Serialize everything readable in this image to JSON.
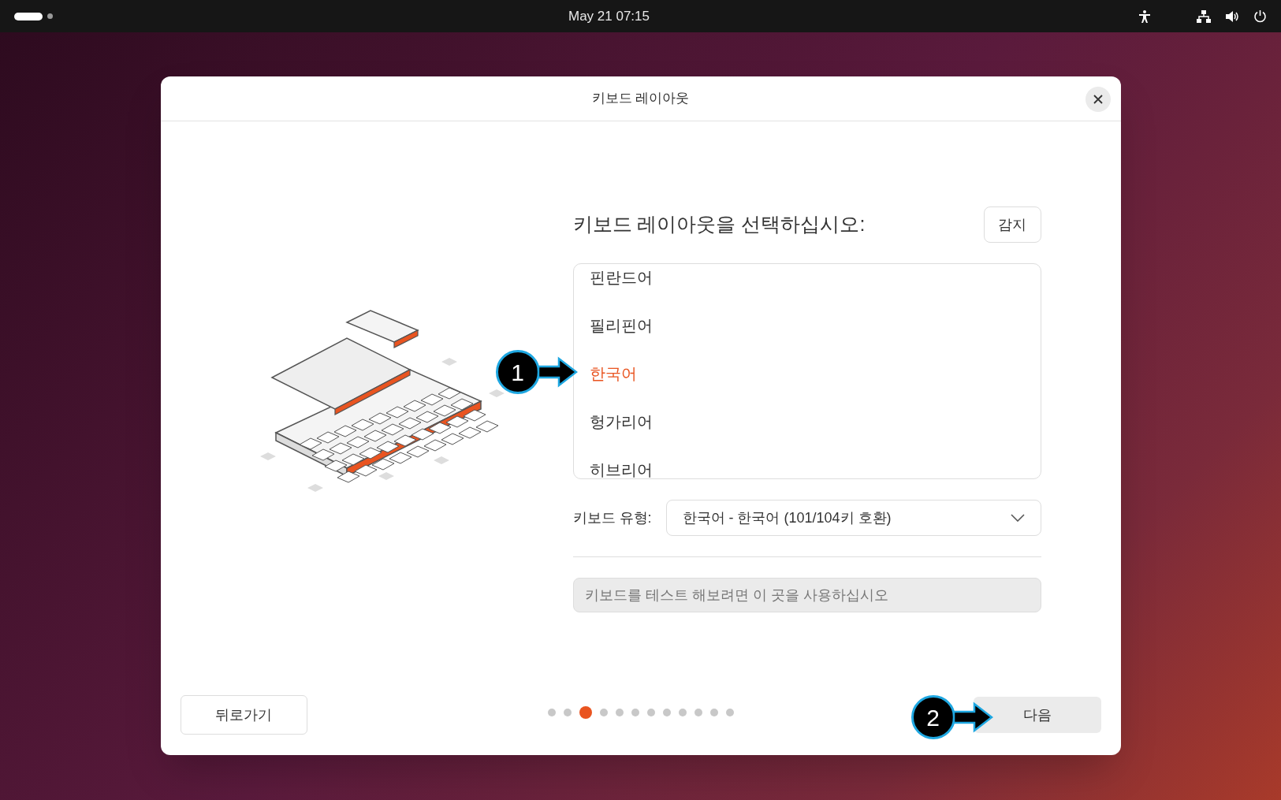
{
  "top_bar": {
    "clock": "May 21  07:15"
  },
  "window": {
    "title": "키보드 레이아웃"
  },
  "heading": "키보드 레이아웃을 선택하십시오:",
  "detect_button": "감지",
  "layouts": [
    {
      "label": "핀란드어",
      "selected": false
    },
    {
      "label": "필리핀어",
      "selected": false
    },
    {
      "label": "한국어",
      "selected": true
    },
    {
      "label": "헝가리어",
      "selected": false
    },
    {
      "label": "히브리어",
      "selected": false
    }
  ],
  "keyboard_type": {
    "label": "키보드 유형:",
    "value": "한국어 - 한국어 (101/104키 호환)"
  },
  "test_field": {
    "placeholder": "키보드를 테스트 해보려면 이 곳을 사용하십시오"
  },
  "back_button": "뒤로가기",
  "steps": [
    {
      "selected": false
    },
    {
      "selected": false
    },
    {
      "selected": true
    },
    {
      "selected": false
    },
    {
      "selected": false
    },
    {
      "selected": false
    },
    {
      "selected": false
    },
    {
      "selected": false
    },
    {
      "selected": false
    },
    {
      "selected": false
    },
    {
      "selected": false
    },
    {
      "selected": false
    }
  ],
  "next_button": "다음",
  "annotations": [
    {
      "number": "1"
    },
    {
      "number": "2"
    }
  ]
}
